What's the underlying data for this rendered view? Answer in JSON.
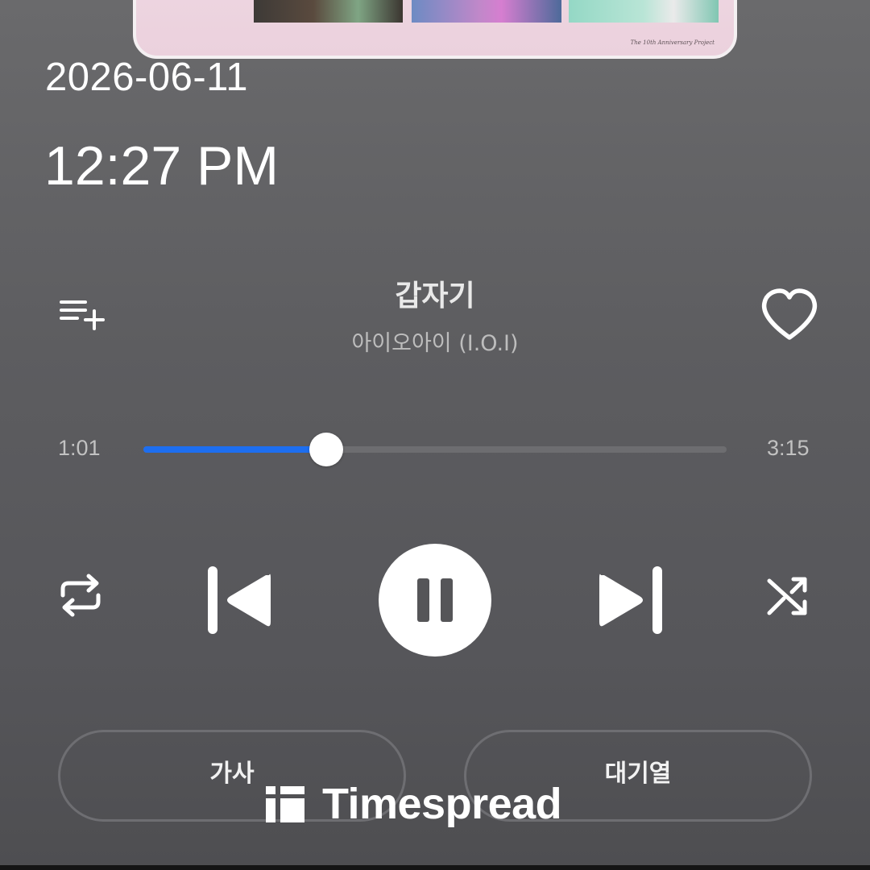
{
  "album": {
    "caption": "The 10th Anniversary Project"
  },
  "clock": {
    "date": "2026-06-11",
    "time": "12:27 PM"
  },
  "track": {
    "title": "갑자기",
    "artist": "아이오아이 (I.O.I)",
    "elapsed": "1:01",
    "duration": "3:15",
    "progress": 0.313
  },
  "controls": {
    "icons": [
      "playlist-add-icon",
      "heart-icon",
      "repeat-icon",
      "previous-track-icon",
      "pause-icon",
      "next-track-icon",
      "shuffle-icon"
    ]
  },
  "buttons": {
    "lyrics": "가사",
    "queue": "대기열"
  },
  "watermark": {
    "brand": "Timespread"
  },
  "colors": {
    "accent": "#1d6ef0",
    "background": "#5e5e61",
    "track": "#6d6d70",
    "white": "#ffffff"
  }
}
